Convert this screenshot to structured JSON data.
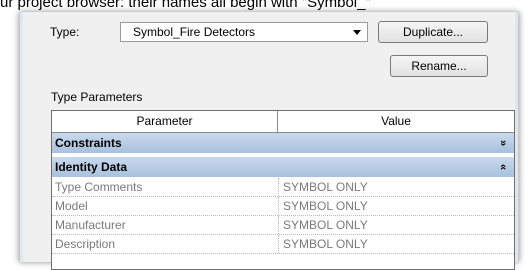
{
  "caption": "ur project browser: their names all begin with \"Symbol_\"",
  "type_label": "Type:",
  "type_value": "Symbol_Fire Detectors",
  "duplicate_label": "Duplicate...",
  "rename_label": "Rename...",
  "type_params_label": "Type Parameters",
  "table": {
    "header_parameter": "Parameter",
    "header_value": "Value",
    "groups": [
      {
        "name": "Constraints",
        "chevron": "»",
        "state": "collapsed"
      },
      {
        "name": "Identity Data",
        "chevron": "«",
        "state": "expanded"
      }
    ],
    "rows": [
      {
        "parameter": "Type Comments",
        "value": "SYMBOL ONLY"
      },
      {
        "parameter": "Model",
        "value": "SYMBOL ONLY"
      },
      {
        "parameter": "Manufacturer",
        "value": "SYMBOL ONLY"
      },
      {
        "parameter": "Description",
        "value": "SYMBOL ONLY"
      }
    ]
  },
  "colors": {
    "group_header": "#b5cbe4",
    "readonly_text": "#7a7a7a"
  }
}
